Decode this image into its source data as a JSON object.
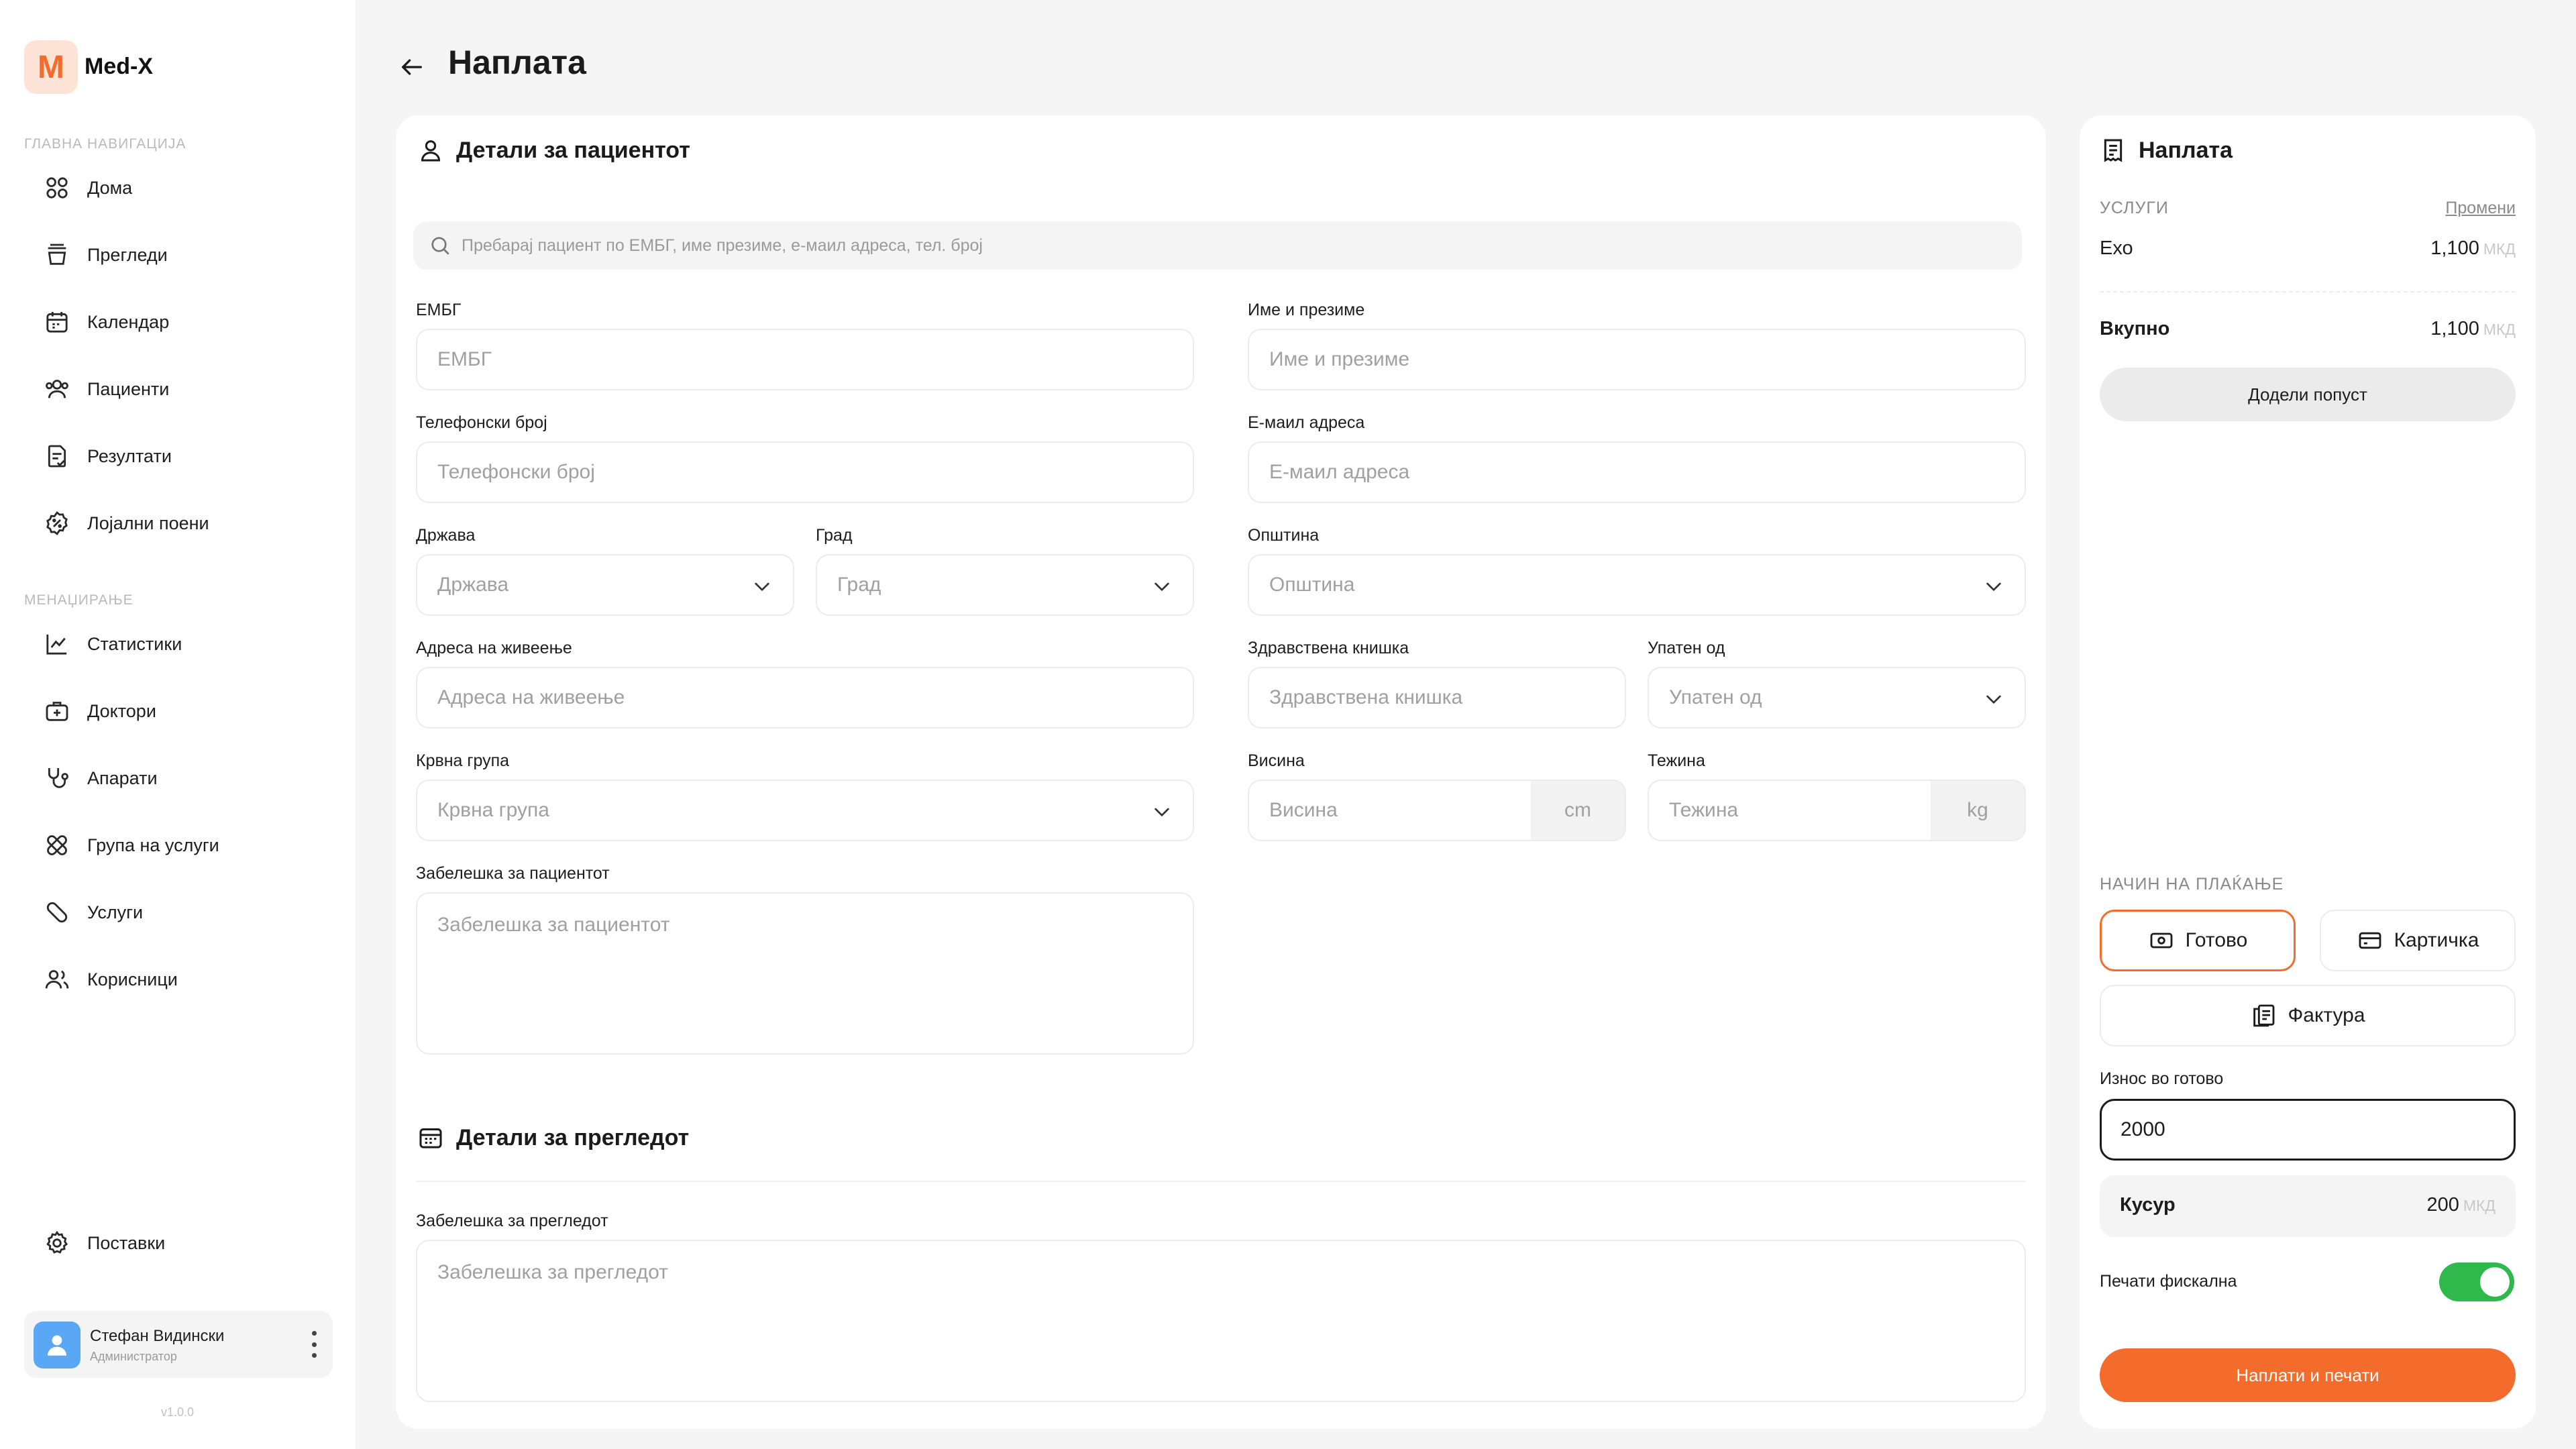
{
  "app": {
    "logo_letter": "M",
    "name": "Med-X",
    "version": "v1.0.0"
  },
  "sidebar": {
    "main_label": "ГЛАВНА НАВИГАЦИЈА",
    "main_items": [
      {
        "label": "Дома",
        "icon": "grid-icon"
      },
      {
        "label": "Прегледи",
        "icon": "tray-icon"
      },
      {
        "label": "Календар",
        "icon": "calendar-icon"
      },
      {
        "label": "Пациенти",
        "icon": "users-icon"
      },
      {
        "label": "Резултати",
        "icon": "document-check-icon"
      },
      {
        "label": "Лојални поени",
        "icon": "badge-percent-icon"
      }
    ],
    "management_label": "МЕНАЏИРАЊЕ",
    "management_items": [
      {
        "label": "Статистики",
        "icon": "chart-line-icon"
      },
      {
        "label": "Доктори",
        "icon": "medical-bag-icon"
      },
      {
        "label": "Апарати",
        "icon": "stethoscope-icon"
      },
      {
        "label": "Група на услуги",
        "icon": "bandages-icon"
      },
      {
        "label": "Услуги",
        "icon": "bandage-icon"
      },
      {
        "label": "Корисници",
        "icon": "user-group-icon"
      }
    ],
    "settings": {
      "label": "Поставки",
      "icon": "gear-icon"
    },
    "user": {
      "name": "Стефан Видински",
      "role": "Администратор"
    }
  },
  "header": {
    "title": "Наплата"
  },
  "patient": {
    "title": "Детали за пациентот",
    "search_placeholder": "Пребарај пациент по ЕМБГ, име презиме, е-маил адреса, тел. број",
    "fields": {
      "embg": {
        "label": "ЕМБГ",
        "placeholder": "ЕМБГ"
      },
      "full_name": {
        "label": "Име и презиме",
        "placeholder": "Име и презиме"
      },
      "phone": {
        "label": "Телефонски број",
        "placeholder": "Телефонски број"
      },
      "email": {
        "label": "Е-маил адреса",
        "placeholder": "Е-маил адреса"
      },
      "country": {
        "label": "Држава",
        "placeholder": "Држава"
      },
      "city": {
        "label": "Град",
        "placeholder": "Град"
      },
      "municipality": {
        "label": "Општина",
        "placeholder": "Општина"
      },
      "address": {
        "label": "Адреса на живеење",
        "placeholder": "Адреса на живеење"
      },
      "health_card": {
        "label": "Здравствена книшка",
        "placeholder": "Здравствена книшка"
      },
      "referred_by": {
        "label": "Упатен од",
        "placeholder": "Упатен од"
      },
      "blood_type": {
        "label": "Крвна група",
        "placeholder": "Крвна група"
      },
      "height": {
        "label": "Висина",
        "placeholder": "Висина",
        "unit": "cm"
      },
      "weight": {
        "label": "Тежина",
        "placeholder": "Тежина",
        "unit": "kg"
      },
      "note": {
        "label": "Забелешка за пациентот",
        "placeholder": "Забелешка за пациентот"
      }
    }
  },
  "exam": {
    "title": "Детали за прегледот",
    "note": {
      "label": "Забелешка за прегледот",
      "placeholder": "Забелешка за прегледот"
    }
  },
  "payment": {
    "title": "Наплата",
    "services_label": "УСЛУГИ",
    "change_link": "Промени",
    "services": [
      {
        "name": "Ехо",
        "amount": "1,100",
        "currency": "МКД"
      }
    ],
    "total_label": "Вкупно",
    "total_amount": "1,100",
    "total_currency": "МКД",
    "discount_button": "Додели попуст",
    "method_label": "НАЧИН НА ПЛАЌАЊЕ",
    "methods": {
      "cash": "Готово",
      "card": "Картичка",
      "invoice": "Фактура"
    },
    "selected_method": "cash",
    "cash_amount_label": "Износ во готово",
    "cash_amount_value": "2000",
    "change_label": "Кусур",
    "change_amount": "200",
    "change_currency": "МКД",
    "fiscal_label": "Печати фискална",
    "fiscal_enabled": true,
    "submit_button": "Наплати и печати"
  },
  "colors": {
    "accent": "#f36c2c",
    "toggle_on": "#2fb84b",
    "avatar": "#5aa8f5"
  }
}
